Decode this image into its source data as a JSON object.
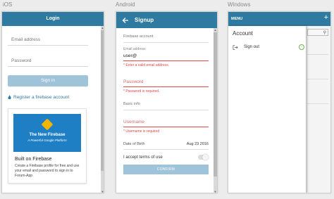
{
  "labels": {
    "ios": "iOS",
    "android": "Android",
    "windows": "Windows"
  },
  "ios": {
    "title": "Login",
    "email_placeholder": "Email address",
    "password_placeholder": "Password",
    "signin_label": "Sign in",
    "register_label": "Register a firebase account",
    "card": {
      "banner_title": "The New Firebase",
      "banner_subtitle": "A Powerful Google Platform",
      "title": "Built on Firebase",
      "description": "Create a Firebase profile for free and use your email and password to sign in to Forum-App"
    }
  },
  "android": {
    "title": "Signup",
    "section_account": "Firebase account",
    "email_label": "Email address",
    "email_value": "user@",
    "email_error": "* Enter a valid email address.",
    "password_placeholder": "Password",
    "password_error": "* Password is required.",
    "section_basic": "Basic info",
    "username_placeholder": "Username",
    "username_error": "* Username is required",
    "dob_label": "Date of Birth",
    "dob_value": "Aug 23 2016",
    "terms_label": "I accept terms of use",
    "confirm_label": "CONFIRM"
  },
  "windows": {
    "menu_title": "MENU",
    "plus_label": "+",
    "account_label": "Account",
    "signout_label": "Sign out"
  },
  "colors": {
    "primary": "#2f7aa0",
    "button_disabled": "#9fc3d9",
    "error": "#e04747",
    "success": "#6ab04c"
  },
  "icons": [
    "back-arrow-icon",
    "flame-icon",
    "sign-out-icon",
    "chevron-right-icon",
    "search-icon",
    "plus-icon"
  ]
}
